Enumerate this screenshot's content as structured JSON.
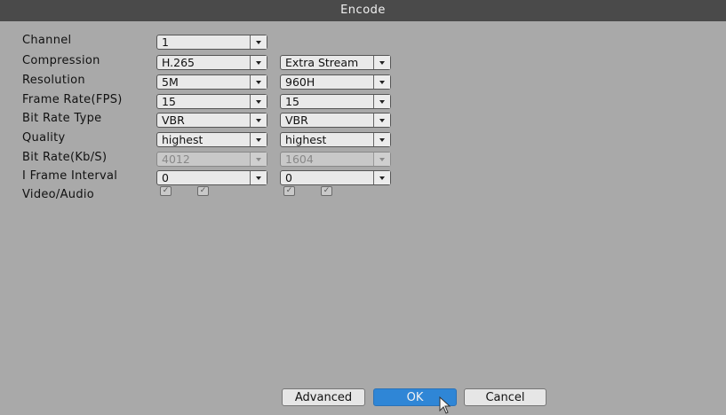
{
  "window": {
    "title": "Encode"
  },
  "labels": {
    "channel": "Channel",
    "compression": "Compression",
    "resolution": "Resolution",
    "frame_rate": "Frame Rate(FPS)",
    "bit_rate_type": "Bit Rate Type",
    "quality": "Quality",
    "bit_rate": "Bit Rate(Kb/S)",
    "i_frame_interval": "I Frame Interval",
    "video_audio": "Video/Audio"
  },
  "main_stream": {
    "channel": "1",
    "compression": "H.265",
    "resolution": "5M",
    "frame_rate": "15",
    "bit_rate_type": "VBR",
    "quality": "highest",
    "bit_rate": "4012",
    "i_frame_interval": "0",
    "video_checked": true,
    "audio_checked": true
  },
  "extra_stream": {
    "compression": "Extra Stream",
    "resolution": "960H",
    "frame_rate": "15",
    "bit_rate_type": "VBR",
    "quality": "highest",
    "bit_rate": "1604",
    "i_frame_interval": "0",
    "video_checked": true,
    "audio_checked": true
  },
  "icons": {
    "dropdown": "chevron-down-icon",
    "check": "checkmark-icon",
    "cursor": "mouse-pointer-icon"
  },
  "buttons": {
    "advanced": "Advanced",
    "ok": "OK",
    "cancel": "Cancel"
  },
  "colors": {
    "titlebar": "#4a4a4a",
    "background": "#a9a9a9",
    "primary_button": "#2f86d6"
  }
}
